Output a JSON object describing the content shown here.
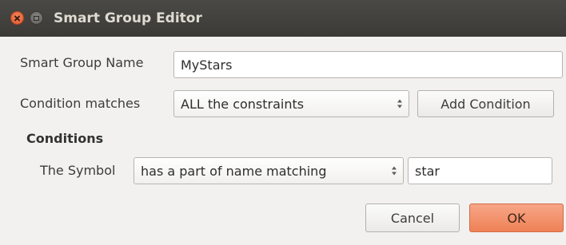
{
  "window": {
    "title": "Smart Group Editor"
  },
  "form": {
    "name_label": "Smart Group Name",
    "name_value": "MyStars",
    "condition_label": "Condition matches",
    "condition_value": "ALL the constraints",
    "add_condition_label": "Add Condition"
  },
  "conditions": {
    "header": "Conditions",
    "rows": [
      {
        "subject": "The Symbol",
        "operator": "has a part of name matching",
        "value": "star"
      }
    ]
  },
  "buttons": {
    "cancel_label": "Cancel",
    "ok_label": "OK"
  },
  "colors": {
    "titlebar": "#3e3d39",
    "close_button": "#e9643a",
    "ok_button": "#f08c64",
    "background": "#f2f1f0"
  }
}
